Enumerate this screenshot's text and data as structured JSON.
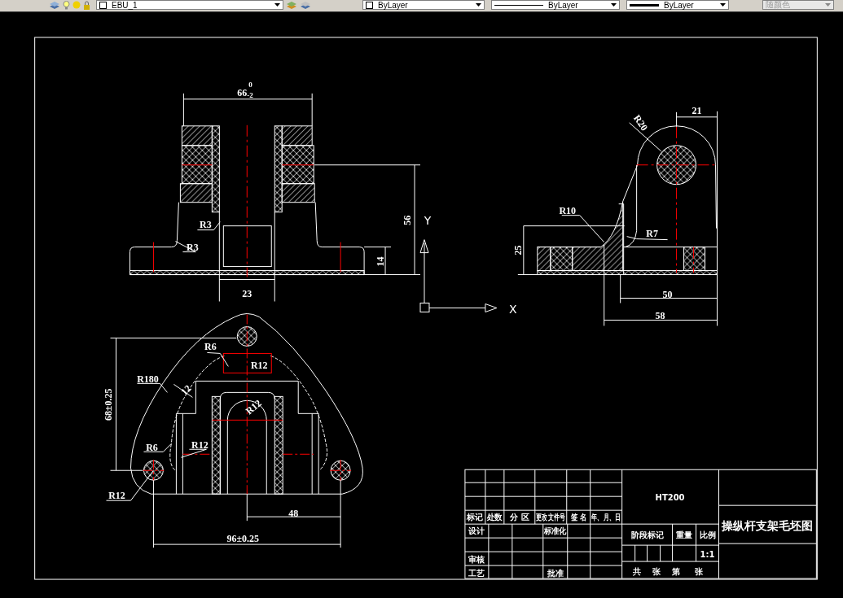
{
  "toolbar": {
    "layer_name": "EBU_1",
    "color_control": "ByLayer",
    "linetype": "ByLayer",
    "lineweight": "ByLayer",
    "plot_style": {
      "label": "随颜色",
      "disabled": true
    }
  },
  "front_view": {
    "width_dim": {
      "value": "66",
      "upper": "0",
      "lower": "-2"
    },
    "labels": [
      "R3",
      "R3",
      "56",
      "14",
      "23"
    ]
  },
  "ucs_icon": {
    "y_label": "Y",
    "x_label": "X"
  },
  "side_view": {
    "labels": [
      "R20",
      "21",
      "R10",
      "R7",
      "25",
      "50",
      "58"
    ]
  },
  "top_view": {
    "labels": [
      "R6",
      "R12",
      "R180",
      "12",
      "R12",
      "68±0.25",
      "R6",
      "R12",
      "R12",
      "48",
      "96±0.25"
    ]
  },
  "title_block": {
    "material": "HT200",
    "title": "操纵杆支架毛坯图",
    "revision_headers": [
      "标记",
      "处数",
      "分 区",
      "更改文件号",
      "签 名",
      "年、月、日"
    ],
    "roles": [
      "设计",
      "标准化",
      "审核",
      "工艺",
      "批准"
    ],
    "stage_headers": [
      "阶段标记",
      "重量",
      "比例"
    ],
    "scale": "1:1",
    "sheet_labels": [
      "共",
      "张",
      "第",
      "张"
    ]
  }
}
